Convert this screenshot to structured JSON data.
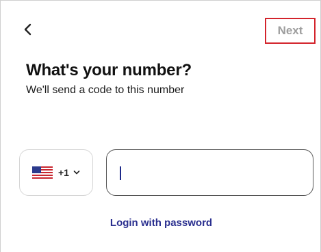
{
  "header": {
    "back_icon": "chevron-left-icon",
    "next_label": "Next"
  },
  "main": {
    "title": "What's your number?",
    "subtitle": "We'll send a code to this number"
  },
  "phone": {
    "country_flag_icon": "us-flag-icon",
    "dial_code": "+1",
    "chevron_icon": "chevron-down-icon",
    "value": "",
    "placeholder": ""
  },
  "footer": {
    "login_link_label": "Login with password"
  },
  "colors": {
    "next_highlight_border": "#d3242c",
    "next_text": "#9e9e9e",
    "link": "#2a2f8f",
    "caret": "#1e2a8a"
  }
}
